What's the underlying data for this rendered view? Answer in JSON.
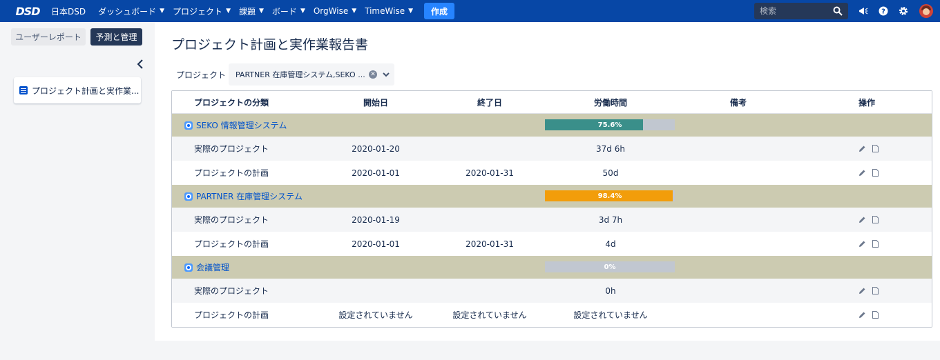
{
  "nav": {
    "logo": "DSD",
    "home": "日本DSD",
    "menus": [
      "ダッシュボード",
      "プロジェクト",
      "課題",
      "ボード",
      "OrgWise",
      "TimeWise"
    ],
    "create": "作成",
    "search_placeholder": "検索"
  },
  "sidebar": {
    "tab_user_report": "ユーザーレポート",
    "tab_forecast": "予測と管理",
    "card_label": "プロジェクト計画と実作業..."
  },
  "main": {
    "title": "プロジェクト計画と実作業報告書",
    "filter_label": "プロジェクト",
    "filter_value": "PARTNER 在庫管理システム,SEKO ..."
  },
  "table": {
    "headers": {
      "category": "プロジェクトの分類",
      "start": "開始日",
      "end": "終了日",
      "hours": "労働時間",
      "note": "備考",
      "ops": "操作"
    },
    "groups": [
      {
        "name": "SEKO 情報管理システム",
        "progress_label": "75.6%",
        "progress": 0.756,
        "bar_color": "#36b37e",
        "rows": [
          {
            "category": "実際のプロジェクト",
            "start": "2020-01-20",
            "end": "",
            "hours": "37d 6h",
            "note": ""
          },
          {
            "category": "プロジェクトの計画",
            "start": "2020-01-01",
            "end": "2020-01-31",
            "hours": "50d",
            "note": ""
          }
        ]
      },
      {
        "name": "PARTNER 在庫管理システム",
        "progress_label": "98.4%",
        "progress": 0.984,
        "bar_color": "#f79e00",
        "rows": [
          {
            "category": "実際のプロジェクト",
            "start": "2020-01-19",
            "end": "",
            "hours": "3d 7h",
            "note": ""
          },
          {
            "category": "プロジェクトの計画",
            "start": "2020-01-01",
            "end": "2020-01-31",
            "hours": "4d",
            "note": ""
          }
        ]
      },
      {
        "name": "会議管理",
        "progress_label": "0%",
        "progress": 0,
        "bar_color": "#c1c7d0",
        "rows": [
          {
            "category": "実際のプロジェクト",
            "start": "",
            "end": "",
            "hours": "0h",
            "note": ""
          },
          {
            "category": "プロジェクトの計画",
            "start": "設定されていません",
            "end": "設定されていません",
            "hours": "設定されていません",
            "note": ""
          }
        ]
      }
    ]
  },
  "colors": {
    "nav_bg": "#0747a6",
    "group_bg": "#cccbb1",
    "bar_seko": "#3a8f8a",
    "bar_partner": "#f29d0a",
    "link": "#0052cc"
  },
  "icons": {
    "search": "search-icon",
    "notifications": "megaphone-icon",
    "help": "help-icon",
    "settings": "gear-icon",
    "edit": "pencil-icon",
    "detail": "document-icon",
    "collapse": "chevron-left-icon"
  }
}
